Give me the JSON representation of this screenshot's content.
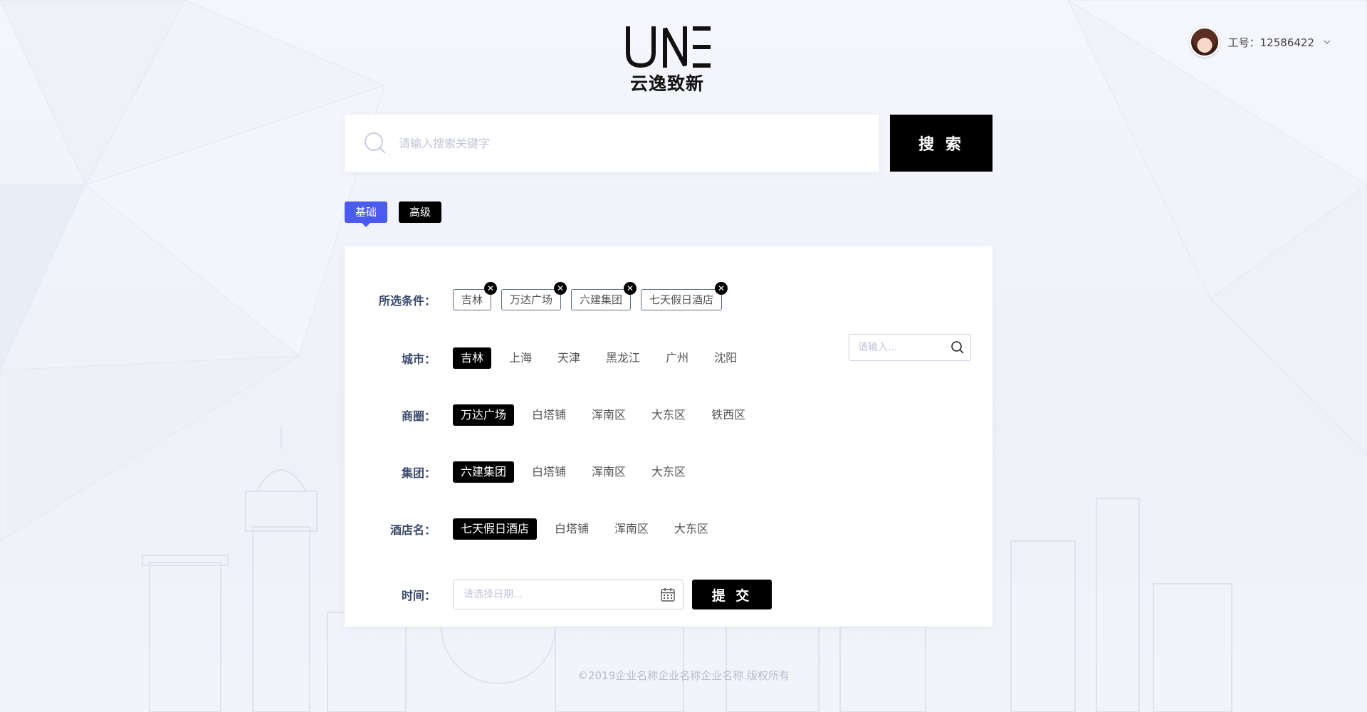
{
  "brand": {
    "mark": "UNE",
    "name": "云逸致新"
  },
  "user": {
    "id_label": "工号：12586422"
  },
  "search": {
    "placeholder": "请输入搜索关键字",
    "button_label": "搜 索"
  },
  "mode_tabs": [
    {
      "label": "基础",
      "active": true
    },
    {
      "label": "高级",
      "active": false
    }
  ],
  "filters": {
    "selected": {
      "label": "所选条件：",
      "tags": [
        "吉林",
        "万达广场",
        "六建集团",
        "七天假日酒店"
      ]
    },
    "city": {
      "label": "城市：",
      "options": [
        "吉林",
        "上海",
        "天津",
        "黑龙江",
        "广州",
        "沈阳"
      ],
      "selected": "吉林",
      "search_placeholder": "请输入..."
    },
    "district": {
      "label": "商圈：",
      "options": [
        "万达广场",
        "白塔铺",
        "浑南区",
        "大东区",
        "铁西区"
      ],
      "selected": "万达广场"
    },
    "group": {
      "label": "集团：",
      "options": [
        "六建集团",
        "白塔铺",
        "浑南区",
        "大东区"
      ],
      "selected": "六建集团"
    },
    "hotel": {
      "label": "酒店名：",
      "options": [
        "七天假日酒店",
        "白塔铺",
        "浑南区",
        "大东区"
      ],
      "selected": "七天假日酒店"
    },
    "time": {
      "label": "时间：",
      "placeholder": "请选择日期...",
      "submit_label": "提 交"
    }
  },
  "footer": {
    "text": "©2019企业名称企业名称企业名称.版权所有"
  },
  "colors": {
    "accent": "#4b5bf0",
    "primary": "#000000",
    "label": "#3a4a6b"
  }
}
